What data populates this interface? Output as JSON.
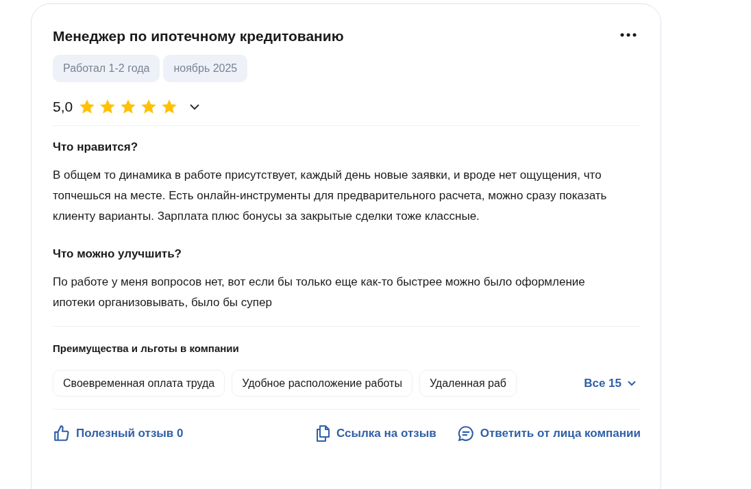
{
  "review": {
    "title": "Менеджер по ипотечному кредитованию",
    "tags": [
      "Работал 1-2 года",
      "ноябрь 2025"
    ],
    "rating": "5,0",
    "stars": 5,
    "sections": [
      {
        "heading": "Что нравится?",
        "text": "В общем то динамика в работе присутствует, каждый день новые заявки, и вроде нет ощущения, что топчешься на месте. Есть онлайн-инструменты для предварительного расчета, можно сразу показать клиенту варианты. Зарплата плюс бонусы за закрытые сделки тоже классные."
      },
      {
        "heading": "Что можно улучшить?",
        "text": "По работе у меня вопросов нет, вот если бы только еще как-то быстрее можно было оформление ипотеки организовывать, было бы супер"
      }
    ],
    "benefits_heading": "Преимущества и льготы в компании",
    "benefits": [
      "Своевременная оплата труда",
      "Удобное расположение работы",
      "Удаленная раб"
    ],
    "benefits_more": "Все 15",
    "actions": [
      {
        "kind": "like",
        "label": "Полезный отзыв 0"
      },
      {
        "kind": "link",
        "label": "Ссылка на отзыв"
      },
      {
        "kind": "reply",
        "label": "Ответить от лица компании"
      }
    ]
  }
}
